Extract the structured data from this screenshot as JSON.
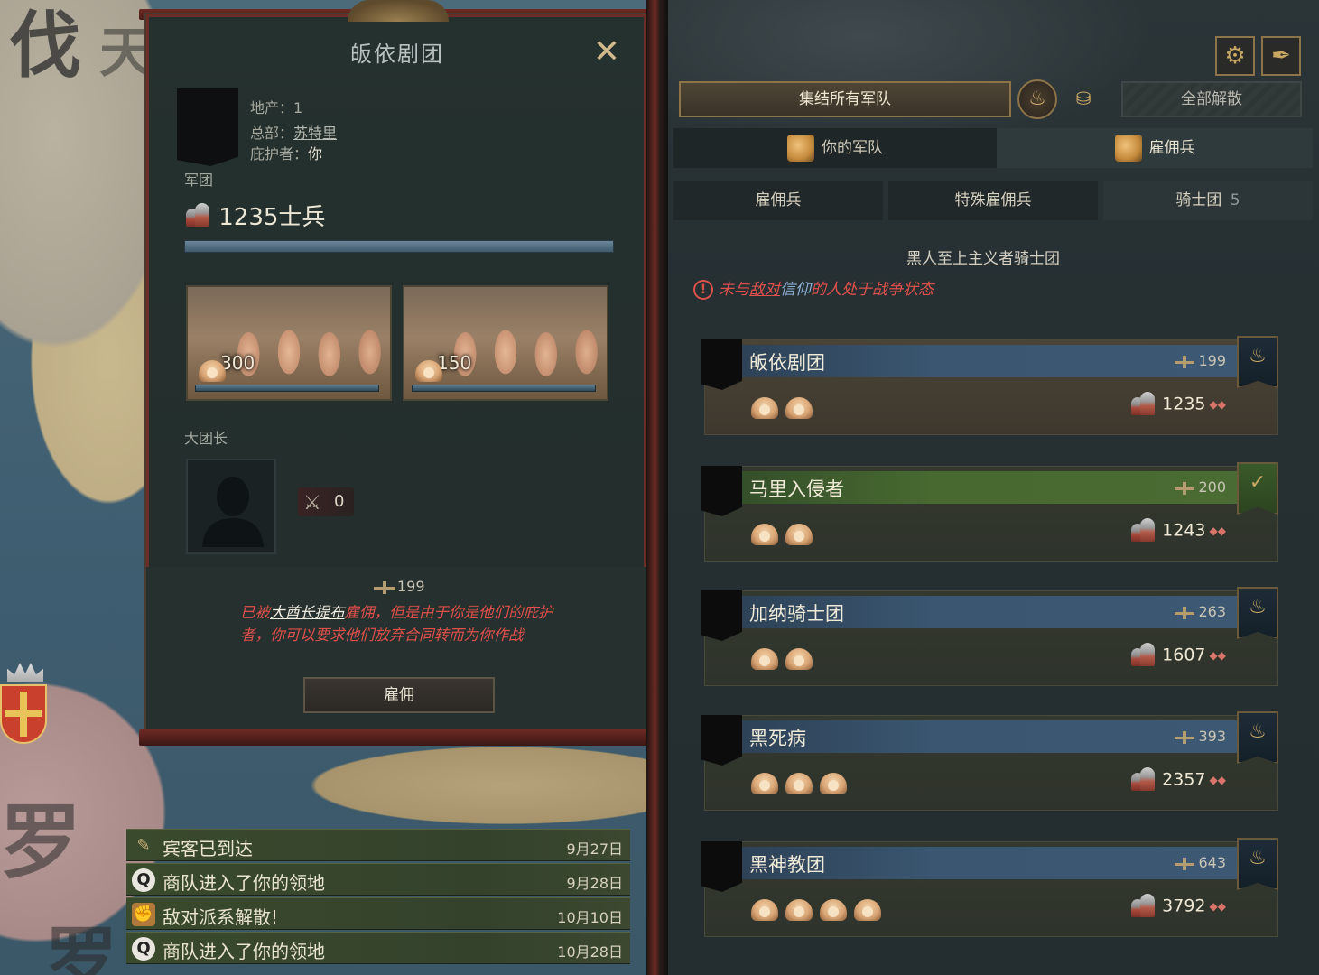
{
  "map": {
    "letters": [
      "伐",
      "天",
      "罗",
      "罗"
    ]
  },
  "left_panel": {
    "title": "皈依剧团",
    "holdings_label": "地产：",
    "holdings_value": "1",
    "hq_label": "总部：",
    "hq_value": "苏特里",
    "patron_label": "庇护者：",
    "patron_value": "你",
    "army_label": "军团",
    "troops_text": "1235士兵",
    "regiments": [
      {
        "count": "300"
      },
      {
        "count": "150"
      }
    ],
    "commander_label": "大团长",
    "prowess_value": "0",
    "cost": "199",
    "warning_parts": [
      "已被",
      "大酋长提布",
      "雇佣，但是由于你是他们的庇护者，你可以要求他们放弃合同转而为你作战"
    ],
    "hire_label": "雇佣"
  },
  "notifications": [
    {
      "icon": "scroll-icon",
      "text": "宾客已到达",
      "date": "9月27日"
    },
    {
      "icon": "q-icon",
      "text": "商队进入了你的领地",
      "date": "9月28日"
    },
    {
      "icon": "fist-icon",
      "text": "敌对派系解散!",
      "date": "10月10日"
    },
    {
      "icon": "q-icon",
      "text": "商队进入了你的领地",
      "date": "10月28日"
    }
  ],
  "right_panel": {
    "rally_label": "集结所有军队",
    "disband_label": "全部解散",
    "tabs": [
      "你的军队",
      "雇佣兵"
    ],
    "subtabs": [
      "雇佣兵",
      "特殊雇佣兵",
      "骑士团"
    ],
    "knights_count": "5",
    "order_title": "黑人至上主义者骑士团",
    "order_warning_parts": [
      "未与",
      "敌对",
      "信仰",
      "的人处于战争状态"
    ],
    "companies": [
      {
        "name": "皈依剧团",
        "cost": "199",
        "soldiers": "1235",
        "arms": 2,
        "status": "selected"
      },
      {
        "name": "马里入侵者",
        "cost": "200",
        "soldiers": "1243",
        "arms": 2,
        "status": "hired"
      },
      {
        "name": "加纳骑士团",
        "cost": "263",
        "soldiers": "1607",
        "arms": 2,
        "status": "normal"
      },
      {
        "name": "黑死病",
        "cost": "393",
        "soldiers": "2357",
        "arms": 3,
        "status": "normal"
      },
      {
        "name": "黑神教团",
        "cost": "643",
        "soldiers": "3792",
        "arms": 4,
        "status": "normal"
      }
    ]
  },
  "colors": {
    "warning": "#e0504a",
    "gold": "#c9a864",
    "hired": "#486a30",
    "namebar": "#3a5670"
  }
}
